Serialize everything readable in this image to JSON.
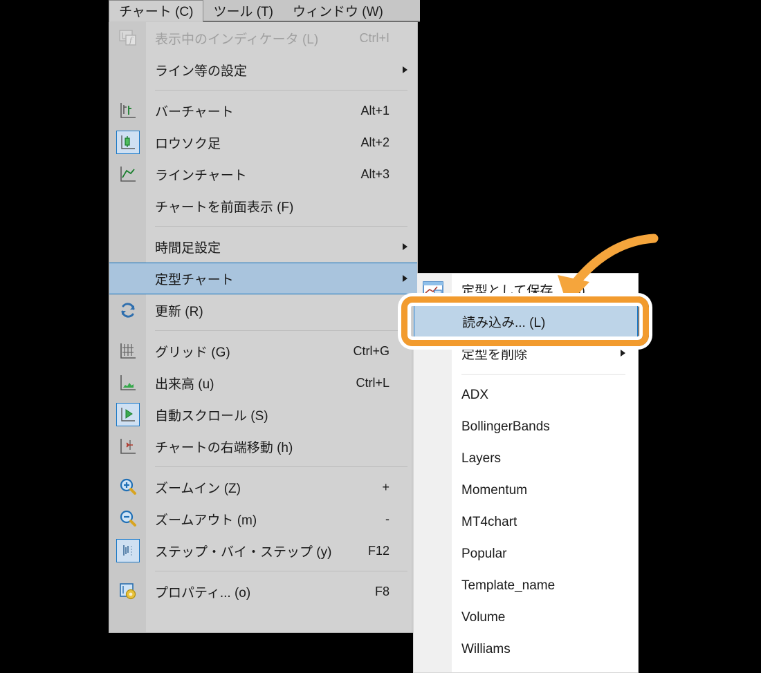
{
  "menubar": {
    "items": [
      {
        "label": "チャート (C)",
        "active": true
      },
      {
        "label": "ツール (T)",
        "active": false
      },
      {
        "label": "ウィンドウ (W)",
        "active": false
      }
    ]
  },
  "chart_menu": {
    "items": [
      {
        "label": "表示中のインディケータ (L)",
        "accel": "Ctrl+I",
        "icon": "indicator-list-icon",
        "disabled": true,
        "submenu": false,
        "selected": false,
        "icon_boxed": false
      },
      {
        "label": "ライン等の設定",
        "accel": "",
        "icon": "",
        "disabled": false,
        "submenu": true,
        "selected": false,
        "icon_boxed": false
      },
      {
        "separator": true
      },
      {
        "label": "バーチャート",
        "accel": "Alt+1",
        "icon": "bar-chart-icon",
        "disabled": false,
        "submenu": false,
        "selected": false,
        "icon_boxed": false
      },
      {
        "label": "ロウソク足",
        "accel": "Alt+2",
        "icon": "candlestick-icon",
        "disabled": false,
        "submenu": false,
        "selected": false,
        "icon_boxed": true
      },
      {
        "label": "ラインチャート",
        "accel": "Alt+3",
        "icon": "line-chart-icon",
        "disabled": false,
        "submenu": false,
        "selected": false,
        "icon_boxed": false
      },
      {
        "label": "チャートを前面表示 (F)",
        "accel": "",
        "icon": "",
        "disabled": false,
        "submenu": false,
        "selected": false,
        "icon_boxed": false
      },
      {
        "separator": true
      },
      {
        "label": "時間足設定",
        "accel": "",
        "icon": "",
        "disabled": false,
        "submenu": true,
        "selected": false,
        "icon_boxed": false
      },
      {
        "label": "定型チャート",
        "accel": "",
        "icon": "",
        "disabled": false,
        "submenu": true,
        "selected": true,
        "icon_boxed": false
      },
      {
        "label": "更新 (R)",
        "accel": "",
        "icon": "refresh-icon",
        "disabled": false,
        "submenu": false,
        "selected": false,
        "icon_boxed": false
      },
      {
        "separator": true
      },
      {
        "label": "グリッド (G)",
        "accel": "Ctrl+G",
        "icon": "grid-icon",
        "disabled": false,
        "submenu": false,
        "selected": false,
        "icon_boxed": false
      },
      {
        "label": "出来高 (u)",
        "accel": "Ctrl+L",
        "icon": "volume-icon",
        "disabled": false,
        "submenu": false,
        "selected": false,
        "icon_boxed": false
      },
      {
        "label": "自動スクロール (S)",
        "accel": "",
        "icon": "auto-scroll-icon",
        "disabled": false,
        "submenu": false,
        "selected": false,
        "icon_boxed": true
      },
      {
        "label": "チャートの右端移動 (h)",
        "accel": "",
        "icon": "shift-end-icon",
        "disabled": false,
        "submenu": false,
        "selected": false,
        "icon_boxed": false
      },
      {
        "separator": true
      },
      {
        "label": "ズームイン (Z)",
        "accel": "+",
        "icon": "zoom-in-icon",
        "disabled": false,
        "submenu": false,
        "selected": false,
        "icon_boxed": false
      },
      {
        "label": "ズームアウト (m)",
        "accel": "-",
        "icon": "zoom-out-icon",
        "disabled": false,
        "submenu": false,
        "selected": false,
        "icon_boxed": false
      },
      {
        "label": "ステップ・バイ・ステップ (y)",
        "accel": "F12",
        "icon": "step-by-step-icon",
        "disabled": false,
        "submenu": false,
        "selected": false,
        "icon_boxed": true
      },
      {
        "separator": true
      },
      {
        "label": "プロパティ... (o)",
        "accel": "F8",
        "icon": "properties-icon",
        "disabled": false,
        "submenu": false,
        "selected": false,
        "icon_boxed": false
      }
    ]
  },
  "template_submenu": {
    "items": [
      {
        "label": "定型として保存... (S)",
        "icon": "save-template-icon",
        "submenu": false,
        "selected": false
      },
      {
        "label": "読み込み... (L)",
        "icon": "",
        "submenu": false,
        "selected": true
      },
      {
        "label": "定型を削除",
        "icon": "",
        "submenu": true,
        "selected": false
      },
      {
        "separator": true
      },
      {
        "label": "ADX",
        "icon": "",
        "submenu": false,
        "selected": false
      },
      {
        "label": "BollingerBands",
        "icon": "",
        "submenu": false,
        "selected": false
      },
      {
        "label": "Layers",
        "icon": "",
        "submenu": false,
        "selected": false
      },
      {
        "label": "Momentum",
        "icon": "",
        "submenu": false,
        "selected": false
      },
      {
        "label": "MT4chart",
        "icon": "",
        "submenu": false,
        "selected": false
      },
      {
        "label": "Popular",
        "icon": "",
        "submenu": false,
        "selected": false
      },
      {
        "label": "Template_name",
        "icon": "",
        "submenu": false,
        "selected": false
      },
      {
        "label": "Volume",
        "icon": "",
        "submenu": false,
        "selected": false
      },
      {
        "label": "Williams",
        "icon": "",
        "submenu": false,
        "selected": false
      }
    ]
  },
  "annotation": {
    "highlight_color": "#F29B2E",
    "arrow_color": "#F5A53C",
    "target_label": "読み込み... (L)"
  },
  "colors": {
    "menu_background": "#d2d2d2",
    "gutter": "#c8c8c8",
    "submenu_background": "#ffffff",
    "selection_fill": "#a9c4dd",
    "selection_border": "#0a6ebd",
    "text": "#1b1b1b",
    "disabled_text": "#a0a0a0",
    "page_background": "#000000"
  }
}
